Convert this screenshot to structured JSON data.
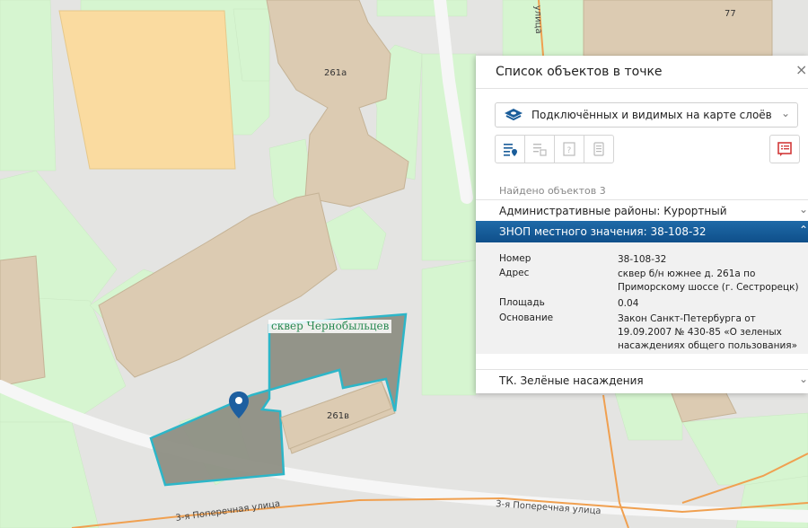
{
  "map": {
    "building_labels": [
      "77",
      "261а",
      "261в"
    ],
    "streets": [
      "3-я Поперечная улица",
      "3-я Поперечная улица"
    ],
    "top_street": "улица",
    "square_label": "сквер Чернобыльцев"
  },
  "panel": {
    "title": "Список объектов в точке",
    "close": "×",
    "layer_select": "Подключённых и видимых на карте слоёв",
    "found": "Найдено объектов 3",
    "categories": [
      {
        "label": "Административные районы: Курортный"
      },
      {
        "label": "ЗНОП местного значения: 38-108-32"
      },
      {
        "label": "ТК. Зелёные насаждения"
      }
    ],
    "attributes": [
      {
        "key": "Номер",
        "value": "38-108-32"
      },
      {
        "key": "Адрес",
        "value": "сквер б/н южнее д. 261а по Приморскому шоссе (г. Сестрорецк)"
      },
      {
        "key": "Площадь",
        "value": "0.04"
      },
      {
        "key": "Основание",
        "value": "Закон Санкт-Петербурга от 19.09.2007 № 430-85 «О зеленых насаждениях общего пользования»"
      }
    ]
  },
  "colors": {
    "green": "#d6f5d0",
    "building": "#dccbb2",
    "selected_fill": "#8e8f84",
    "selected_outline": "#2db6c8",
    "road_orange": "#f0a050",
    "active_row": "#1a5d9a"
  }
}
